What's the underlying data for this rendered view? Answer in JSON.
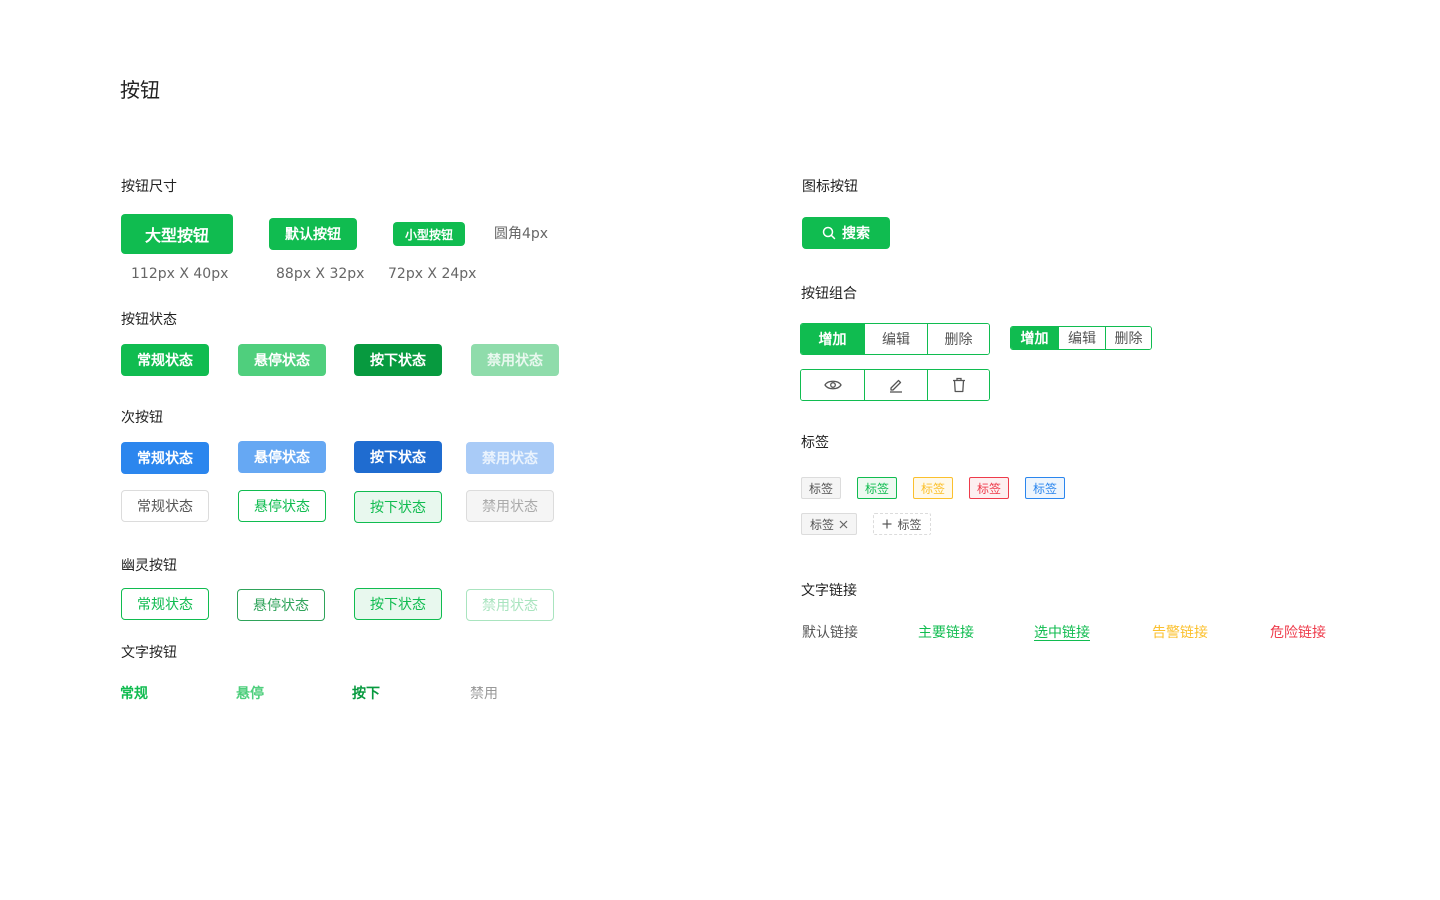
{
  "page": {
    "title": "按钮"
  },
  "left": {
    "sizes": {
      "title": "按钮尺寸",
      "large_label": "大型按钮",
      "default_label": "默认按钮",
      "small_label": "小型按钮",
      "radius_note": "圆角4px",
      "large_caption": "112px X 40px",
      "default_caption": "88px X 32px",
      "small_caption": "72px X 24px"
    },
    "states": {
      "title": "按钮状态",
      "normal": "常规状态",
      "hover": "悬停状态",
      "pressed": "按下状态",
      "disabled": "禁用状态"
    },
    "secondary": {
      "title": "次按钮",
      "normal": "常规状态",
      "hover": "悬停状态",
      "pressed": "按下状态",
      "disabled": "禁用状态"
    },
    "ghost": {
      "title": "幽灵按钮",
      "normal": "常规状态",
      "hover": "悬停状态",
      "pressed": "按下状态",
      "disabled": "禁用状态"
    },
    "text_buttons": {
      "title": "文字按钮",
      "normal": "常规",
      "hover": "悬停",
      "pressed": "按下",
      "disabled": "禁用"
    }
  },
  "right": {
    "icon_buttons": {
      "title": "图标按钮",
      "search_label": "搜索",
      "search_icon": "search-icon"
    },
    "groups": {
      "title": "按钮组合",
      "large": [
        "增加",
        "编辑",
        "删除"
      ],
      "small": [
        "增加",
        "编辑",
        "删除"
      ],
      "icons": [
        "eye-icon",
        "edit-icon",
        "trash-icon"
      ]
    },
    "tags": {
      "title": "标签",
      "items": [
        "标签",
        "标签",
        "标签",
        "标签",
        "标签"
      ],
      "closable": "标签",
      "addable": "标签"
    },
    "links": {
      "title": "文字链接",
      "default": "默认链接",
      "primary": "主要链接",
      "selected": "选中链接",
      "warning": "告警链接",
      "danger": "危险链接"
    }
  },
  "colors": {
    "primary": "#10bc50",
    "primary_hover": "#4fcf7d",
    "primary_pressed": "#079a3f",
    "secondary": "#2b86ee",
    "warning": "#fbc02d",
    "danger": "#ee3b4b"
  }
}
